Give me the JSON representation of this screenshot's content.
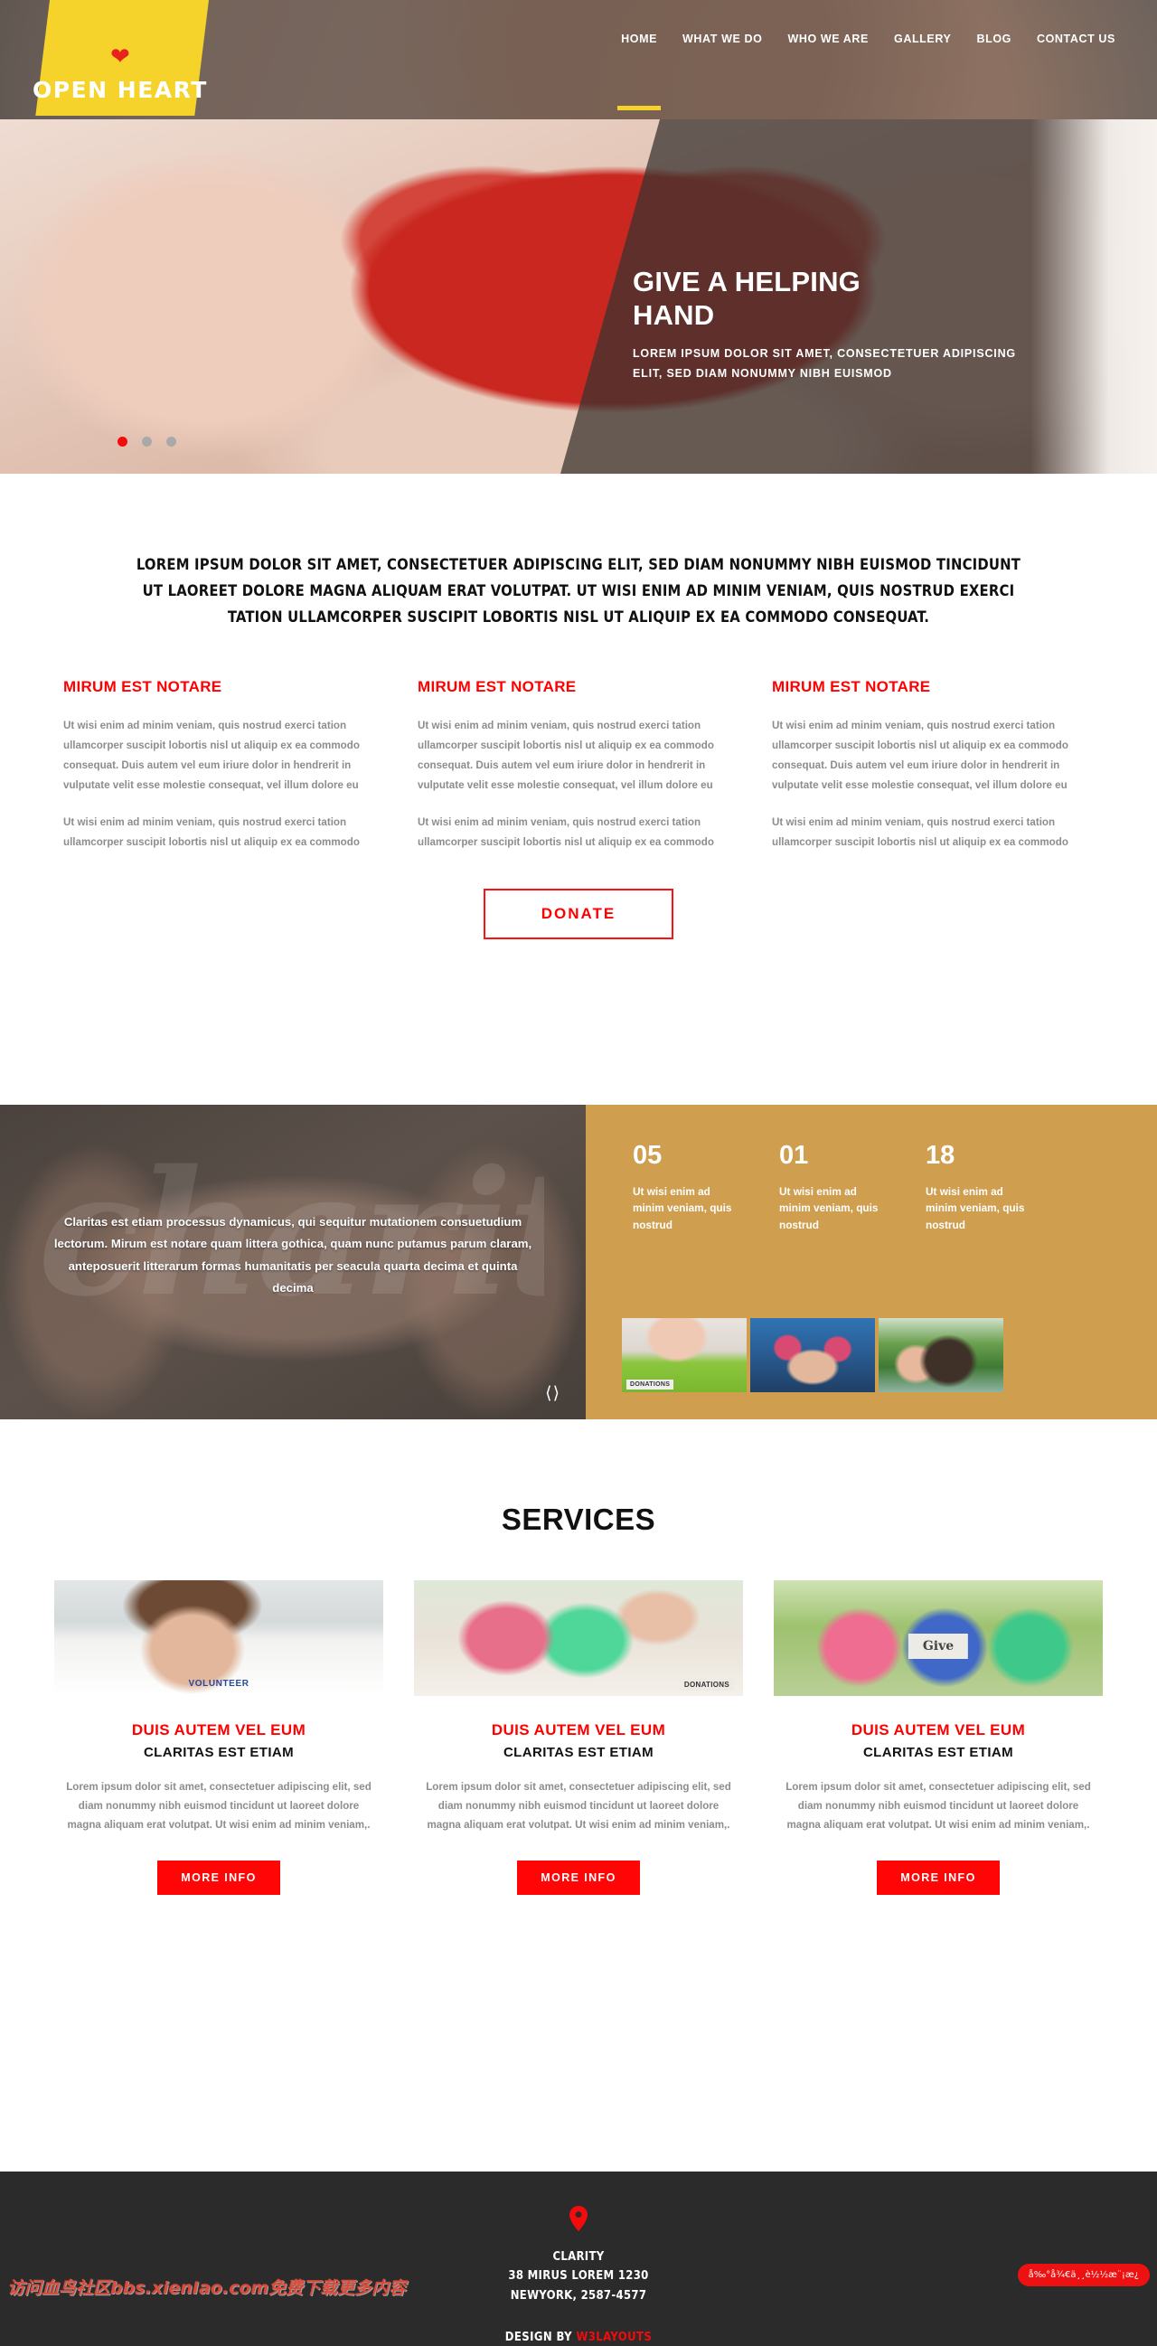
{
  "header": {
    "logo": {
      "heart_icon": "heart-icon",
      "text": "OPEN HEART"
    },
    "nav": [
      {
        "label": "HOME",
        "active": true
      },
      {
        "label": "WHAT WE DO",
        "active": false
      },
      {
        "label": "WHO WE ARE",
        "active": false
      },
      {
        "label": "GALLERY",
        "active": false
      },
      {
        "label": "BLOG",
        "active": false
      },
      {
        "label": "CONTACT US",
        "active": false
      }
    ]
  },
  "hero": {
    "title": "GIVE A HELPING HAND",
    "subtitle": "LOREM IPSUM DOLOR SIT AMET, CONSECTETUER ADIPISCING ELIT, SED DIAM NONUMMY NIBH EUISMOD",
    "slide_count": 3,
    "active_slide": 1,
    "active_dot_color": "#f40b0b",
    "inactive_dot_color": "#a9a9a9"
  },
  "intro": {
    "paragraph": "LOREM IPSUM DOLOR SIT AMET, CONSECTETUER ADIPISCING ELIT, SED DIAM NONUMMY NIBH EUISMOD TINCIDUNT UT LAOREET DOLORE MAGNA ALIQUAM ERAT VOLUTPAT. UT WISI ENIM AD MINIM VENIAM, QUIS NOSTRUD EXERCI TATION ULLAMCORPER SUSCIPIT LOBORTIS NISL UT ALIQUIP EX EA COMMODO CONSEQUAT.",
    "columns": [
      {
        "heading": "MIRUM EST NOTARE",
        "p1": "Ut wisi enim ad minim veniam, quis nostrud exerci tation ullamcorper suscipit lobortis nisl ut aliquip ex ea commodo consequat. Duis autem vel eum iriure dolor in hendrerit in vulputate velit esse molestie consequat, vel illum dolore eu",
        "p2": "Ut wisi enim ad minim veniam, quis nostrud exerci tation ullamcorper suscipit lobortis nisl ut aliquip ex ea commodo"
      },
      {
        "heading": "MIRUM EST NOTARE",
        "p1": "Ut wisi enim ad minim veniam, quis nostrud exerci tation ullamcorper suscipit lobortis nisl ut aliquip ex ea commodo consequat. Duis autem vel eum iriure dolor in hendrerit in vulputate velit esse molestie consequat, vel illum dolore eu",
        "p2": "Ut wisi enim ad minim veniam, quis nostrud exerci tation ullamcorper suscipit lobortis nisl ut aliquip ex ea commodo"
      },
      {
        "heading": "MIRUM EST NOTARE",
        "p1": "Ut wisi enim ad minim veniam, quis nostrud exerci tation ullamcorper suscipit lobortis nisl ut aliquip ex ea commodo consequat. Duis autem vel eum iriure dolor in hendrerit in vulputate velit esse molestie consequat, vel illum dolore eu",
        "p2": "Ut wisi enim ad minim veniam, quis nostrud exerci tation ullamcorper suscipit lobortis nisl ut aliquip ex ea commodo"
      }
    ],
    "donate_label": "DONATE"
  },
  "band": {
    "watermark_word": "charity",
    "quote": "Claritas est etiam processus dynamicus, qui sequitur mutationem consuetudium lectorum. Mirum est notare quam littera gothica, quam nunc putamus parum claram, anteposuerit litterarum formas humanitatis per seacula quarta decima et quinta decima",
    "prev_icon": "chevron-left-icon",
    "next_icon": "chevron-right-icon",
    "arrows": "‹ ›",
    "background_color": "#cf9e4f",
    "stats": [
      {
        "number": "05",
        "label": "Ut wisi enim ad minim veniam, quis nostrud"
      },
      {
        "number": "01",
        "label": "Ut wisi enim ad minim veniam, quis nostrud"
      },
      {
        "number": "18",
        "label": "Ut wisi enim ad minim veniam, quis nostrud"
      }
    ],
    "thumbs": [
      {
        "name": "donations-box-photo",
        "caption": "DONATIONS"
      },
      {
        "name": "hands-together-photo",
        "caption": ""
      },
      {
        "name": "hugging-children-photo",
        "caption": ""
      }
    ]
  },
  "services": {
    "title": "SERVICES",
    "cards": [
      {
        "image_name": "volunteers-photo",
        "image_caption": "VOLUNTEER",
        "heading": "DUIS AUTEM VEL EUM",
        "subheading": "CLARITAS EST ETIAM",
        "body": "Lorem ipsum dolor sit amet, consectetuer adipiscing elit, sed diam nonummy nibh euismod tincidunt ut laoreet dolore magna aliquam erat volutpat. Ut wisi enim ad minim veniam,.",
        "button": "MORE INFO"
      },
      {
        "image_name": "donation-children-photo",
        "image_caption": "DONATIONS",
        "heading": "DUIS AUTEM VEL EUM",
        "subheading": "CLARITAS EST ETIAM",
        "body": "Lorem ipsum dolor sit amet, consectetuer adipiscing elit, sed diam nonummy nibh euismod tincidunt ut laoreet dolore magna aliquam erat volutpat. Ut wisi enim ad minim veniam,.",
        "button": "MORE INFO"
      },
      {
        "image_name": "give-sign-children-photo",
        "image_caption": "Give",
        "heading": "DUIS AUTEM VEL EUM",
        "subheading": "CLARITAS EST ETIAM",
        "body": "Lorem ipsum dolor sit amet, consectetuer adipiscing elit, sed diam nonummy nibh euismod tincidunt ut laoreet dolore magna aliquam erat volutpat. Ut wisi enim ad minim veniam,.",
        "button": "MORE INFO"
      }
    ]
  },
  "footer": {
    "pin_icon": "map-pin-icon",
    "company": "CLARITY",
    "address_line": "38 MIRUS LOREM 1230",
    "city_zip": "NEWYORK, 2587-4577",
    "design_by_prefix": "DESIGN BY ",
    "design_by_brand": "W3LAYOUTS",
    "accent_color": "#f40b0b",
    "background_color": "#2b2b2b"
  },
  "overlays": {
    "watermark_text": "访问血鸟社区bbs.xienIao.com免费下载更多内容",
    "corner_badge_text": "å‰°å¾€ä¸¸è½½æ¨¡æ¿"
  }
}
